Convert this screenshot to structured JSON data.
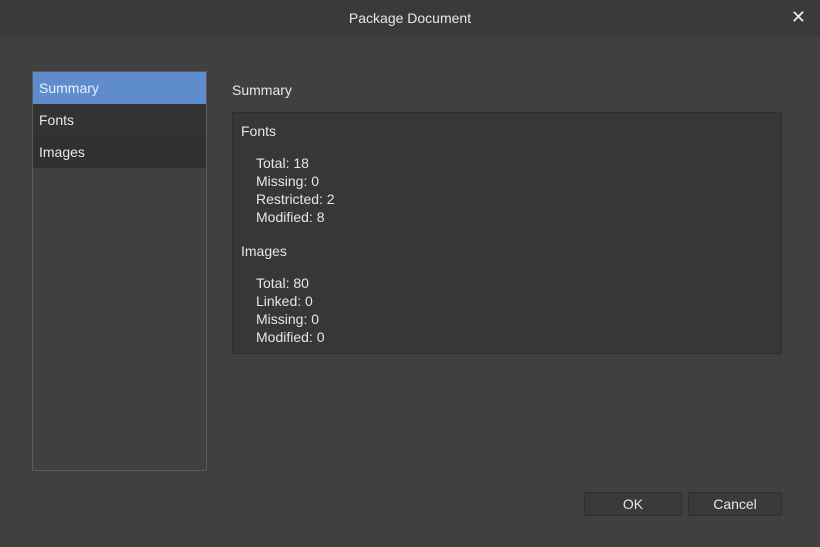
{
  "window": {
    "title": "Package Document"
  },
  "sidebar": {
    "items": [
      {
        "label": "Summary"
      },
      {
        "label": "Fonts"
      },
      {
        "label": "Images"
      }
    ]
  },
  "main": {
    "heading": "Summary",
    "fonts": {
      "title": "Fonts",
      "lines": [
        "Total: 18",
        "Missing: 0",
        "Restricted: 2",
        "Modified: 8"
      ]
    },
    "images": {
      "title": "Images",
      "lines": [
        "Total: 80",
        "Linked: 0",
        "Missing: 0",
        "Modified: 0"
      ]
    }
  },
  "buttons": {
    "ok": "OK",
    "cancel": "Cancel"
  }
}
